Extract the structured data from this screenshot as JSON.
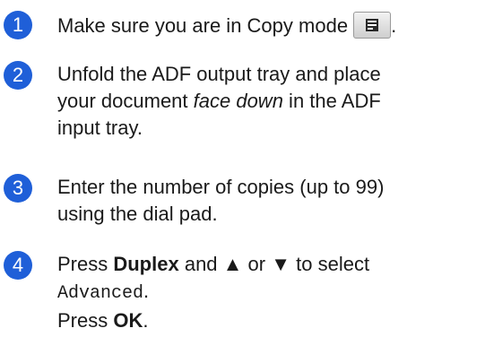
{
  "steps": [
    {
      "number": "1",
      "text_a": "Make sure you are in Copy mode",
      "icon": "copy-mode-icon",
      "text_end": "."
    },
    {
      "number": "2",
      "line1": "Unfold the ADF output tray and place",
      "line2_a": "your document ",
      "line2_em": "face down",
      "line2_b": " in the ADF",
      "line3": "input tray."
    },
    {
      "number": "3",
      "line1": "Enter the number of copies (up to 99)",
      "line2": "using the dial pad."
    },
    {
      "number": "4",
      "press": "Press ",
      "duplex": "Duplex",
      "and": " and ",
      "up": "▲",
      "or": " or ",
      "down": "▼",
      "to_select": " to select",
      "option": "Advanced",
      "option_end": ".",
      "press2": "Press ",
      "ok": "OK",
      "ok_end": "."
    }
  ],
  "colors": {
    "bullet": "#1f5fd8"
  }
}
